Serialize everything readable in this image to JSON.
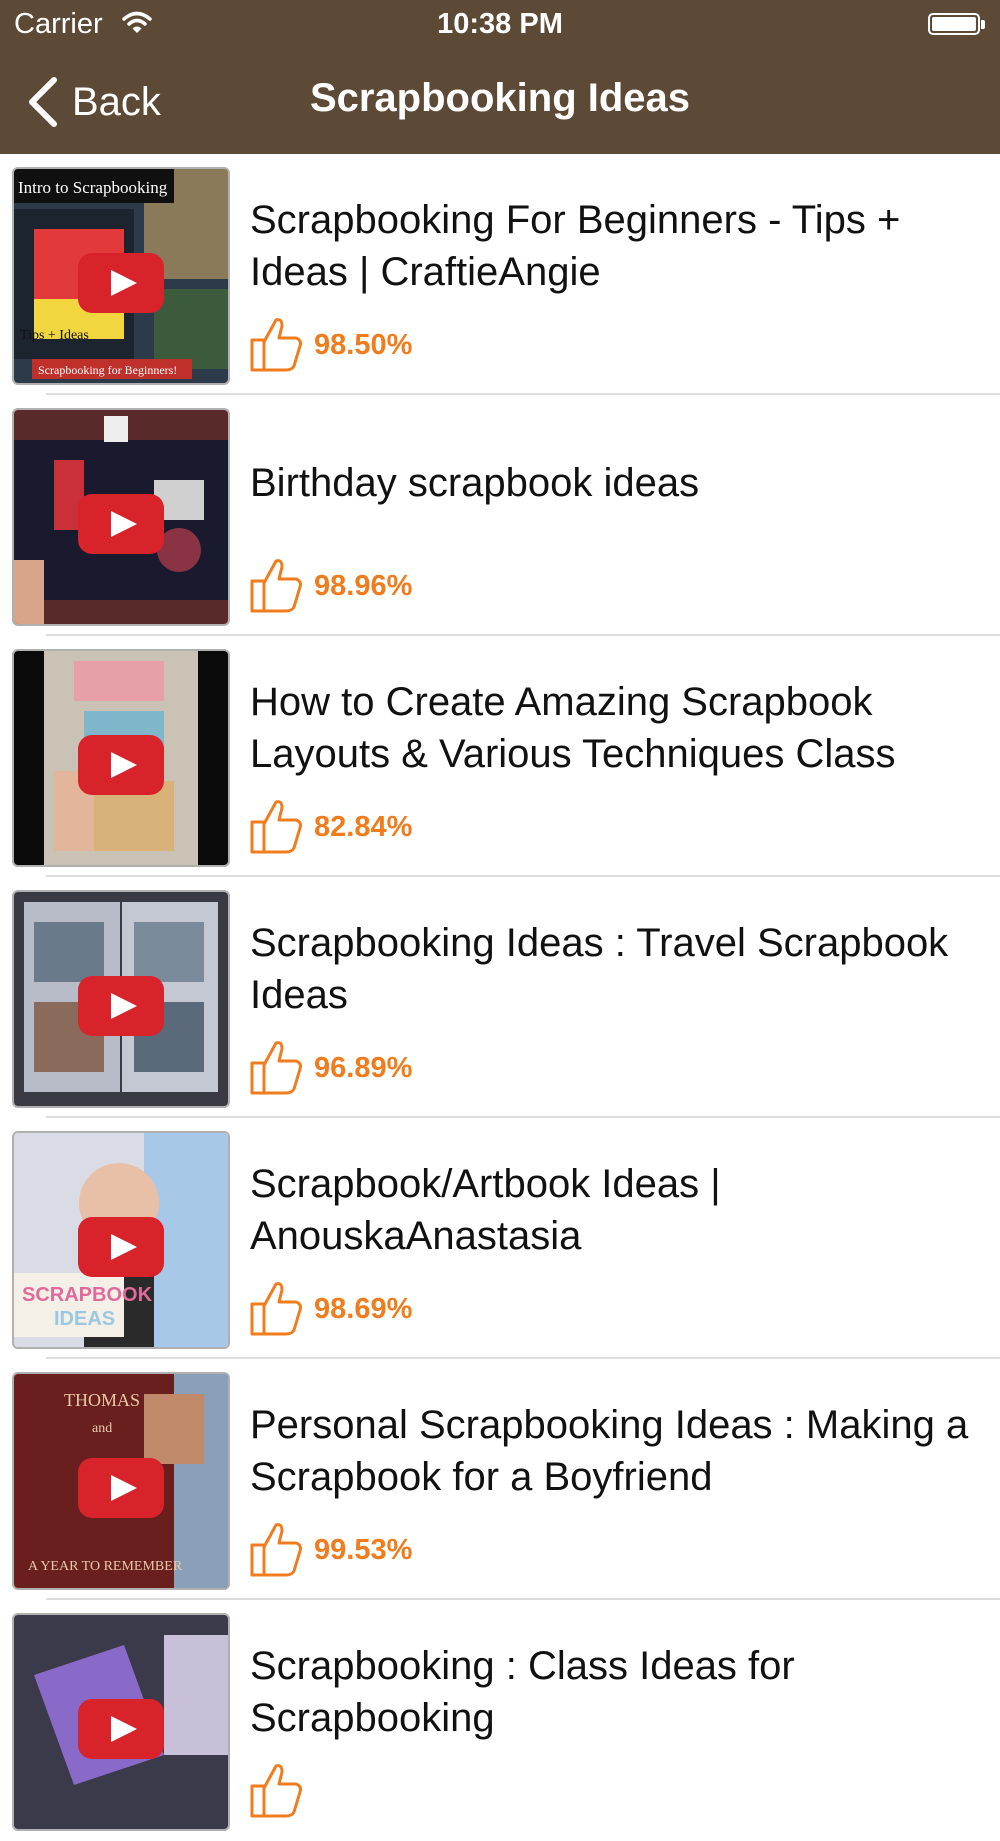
{
  "status": {
    "carrier": "Carrier",
    "time": "10:38 PM"
  },
  "nav": {
    "back_label": "Back",
    "title": "Scrapbooking Ideas"
  },
  "colors": {
    "nav_bg": "#5c4a37",
    "accent": "#f07c1e",
    "play_red": "#d8232a"
  },
  "videos": [
    {
      "title": "Scrapbooking For Beginners - Tips + Ideas  | CraftieAngie",
      "rating": "98.50%",
      "thumb_caption_top": "Intro to Scrapbooking",
      "thumb_caption_mid": "Tips + Ideas",
      "thumb_caption_bottom": "Scrapbooking for Beginners!"
    },
    {
      "title": "Birthday scrapbook ideas",
      "rating": "98.96%"
    },
    {
      "title": "How to Create Amazing Scrapbook Layouts & Various Techniques Class",
      "rating": "82.84%"
    },
    {
      "title": "Scrapbooking Ideas : Travel Scrapbook Ideas",
      "rating": "96.89%"
    },
    {
      "title": "Scrapbook/Artbook Ideas | AnouskaAnastasia",
      "rating": "98.69%",
      "thumb_caption_top": "SCRAPBOOK",
      "thumb_caption_bottom": "IDEAS"
    },
    {
      "title": "Personal Scrapbooking Ideas : Making a Scrapbook for a Boyfriend",
      "rating": "99.53%",
      "thumb_caption_top": "THOMAS",
      "thumb_caption_mid": "and",
      "thumb_caption_bottom": "A YEAR TO REMEMBER"
    },
    {
      "title": "Scrapbooking : Class Ideas for Scrapbooking",
      "rating": ""
    }
  ]
}
